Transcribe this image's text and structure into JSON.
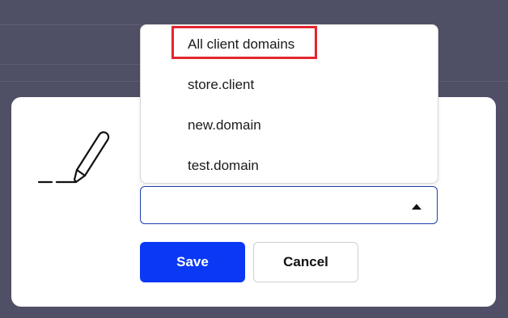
{
  "dropdown": {
    "options": [
      {
        "label": "All client domains",
        "highlighted": true
      },
      {
        "label": "store.client"
      },
      {
        "label": "new.domain"
      },
      {
        "label": "test.domain"
      }
    ],
    "highlight_color": "#e3262e"
  },
  "form": {
    "select_value": "",
    "save_label": "Save",
    "cancel_label": "Cancel"
  },
  "colors": {
    "background": "#4f4f66",
    "primary": "#0a38f5",
    "select_border": "#1d3fae"
  },
  "icons": {
    "signature": "pen-signature-icon",
    "caret": "caret-up-icon"
  }
}
